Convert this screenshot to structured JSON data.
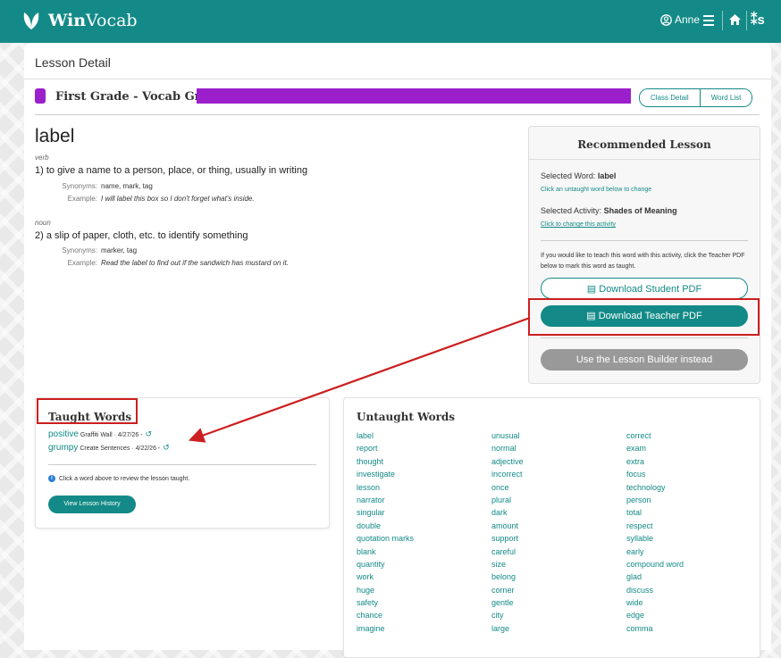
{
  "header": {
    "brand_bold": "Win",
    "brand_rest": "Vocab",
    "user": "Anne"
  },
  "page": {
    "title": "Lesson Detail",
    "class_name": "First Grade - Vocab Gr 1",
    "class_detail_label": "Class Detail",
    "word_list_label": "Word List"
  },
  "word": {
    "term": "label",
    "senses": [
      {
        "pos": "verb",
        "definition": "1) to give a name to a person, place, or thing, usually in writing",
        "synonyms_label": "Synonyms:",
        "synonyms": "name, mark, tag",
        "example_label": "Example:",
        "example": "I will label this box so I don't forget what's inside."
      },
      {
        "pos": "noun",
        "definition": "2) a slip of paper, cloth, etc. to identify something",
        "synonyms_label": "Synonyms:",
        "synonyms": "marker, tag",
        "example_label": "Example:",
        "example": "Read the label to find out if the sandwich has mustard on it."
      }
    ]
  },
  "recommended": {
    "title": "Recommended Lesson",
    "selected_word_label": "Selected Word:",
    "selected_word": "label",
    "change_word_link": "Click an untaught word below to change",
    "selected_activity_label": "Selected Activity:",
    "selected_activity": "Shades of Meaning",
    "change_activity_link": "Click to change this activity",
    "note": "If you would like to teach this word with this activity, click the Teacher PDF below to mark this word as taught.",
    "student_pdf": "Download Student PDF",
    "teacher_pdf": "Download Teacher PDF",
    "lesson_builder": "Use the Lesson Builder instead"
  },
  "taught": {
    "title": "Taught Words",
    "items": [
      {
        "word": "positive",
        "meta": "Graffiti Wall · 4/27/26 -"
      },
      {
        "word": "grumpy",
        "meta": "Create Sentences · 4/22/26 -"
      }
    ],
    "info": "Click a word above to review the lesson taught.",
    "history_button": "View Lesson History"
  },
  "untaught": {
    "title": "Untaught Words",
    "columns": [
      [
        "label",
        "report",
        "thought",
        "investigate",
        "lesson",
        "narrator",
        "singular",
        "double",
        "quotation marks",
        "blank",
        "quantity",
        "work",
        "huge",
        "safety",
        "chance",
        "imagine"
      ],
      [
        "unusual",
        "normal",
        "adjective",
        "incorrect",
        "once",
        "plural",
        "dark",
        "amount",
        "support",
        "careful",
        "size",
        "belong",
        "corner",
        "gentle",
        "city",
        "large"
      ],
      [
        "correct",
        "exam",
        "extra",
        "focus",
        "technology",
        "person",
        "total",
        "respect",
        "syllable",
        "early",
        "compound word",
        "glad",
        "discuss",
        "wide",
        "edge",
        "comma"
      ]
    ]
  },
  "colors": {
    "teal": "#138a87",
    "purple": "#9b1fcb",
    "highlight_red": "#cc1f1f",
    "gray_button": "#999999"
  }
}
